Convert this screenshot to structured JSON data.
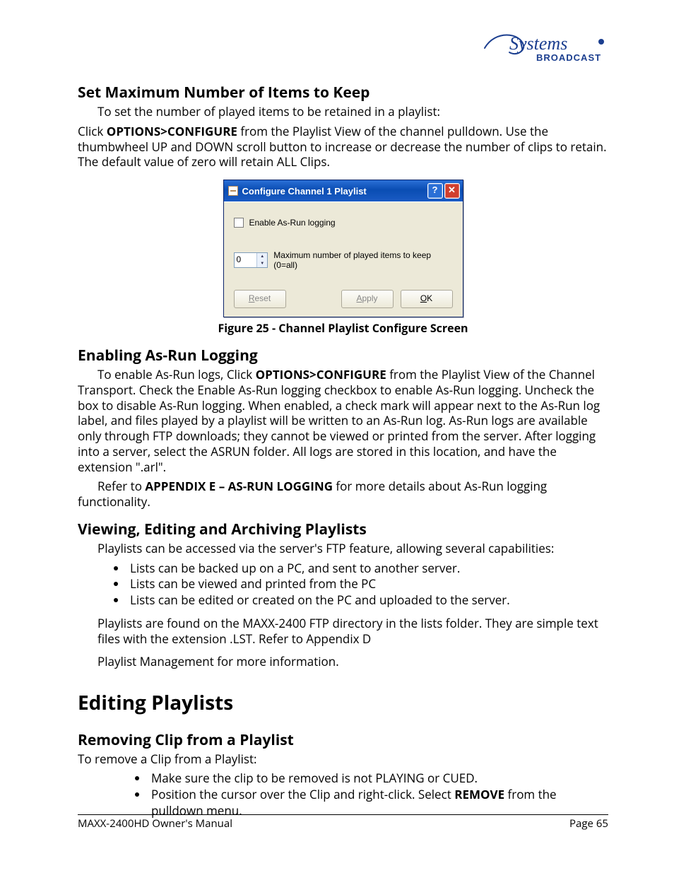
{
  "logo": {
    "brand_top": "360 Systems",
    "brand_sub": "BROADCAST"
  },
  "sec1": {
    "title": "Set Maximum Number of Items to Keep",
    "p1_a": "To set the number of played items to be retained in a playlist:",
    "p2_a": "Click ",
    "p2_b": "OPTIONS>CONFIGURE",
    "p2_c": " from the Playlist View of the channel pulldown. Use the thumbwheel UP and DOWN scroll button to increase or decrease the number of clips to retain. The default value of zero will retain ALL Clips."
  },
  "dialog": {
    "title": "Configure Channel 1 Playlist",
    "help_glyph": "?",
    "close_glyph": "✕",
    "enable_label": "Enable As-Run logging",
    "spin_value": "0",
    "spin_label": "Maximum number of played items to keep (0=all)",
    "reset_u": "R",
    "reset_rest": "eset",
    "apply_u": "A",
    "apply_rest": "pply",
    "ok_u": "O",
    "ok_rest": "K"
  },
  "fig_caption": "Figure 25 - Channel Playlist Configure Screen",
  "sec2": {
    "title": "Enabling As-Run Logging",
    "p1_a": "To enable As-Run logs, Click ",
    "p1_b": "OPTIONS>CONFIGURE",
    "p1_c": " from the Playlist View of the Channel Transport. Check the Enable As-Run logging checkbox to enable As-Run logging. Uncheck the box to disable As-Run logging.  When enabled, a check mark will appear next to the As-Run log label, and files played by a playlist will be written to an As-Run log. As-Run logs are available only through FTP downloads; they cannot be viewed or printed from the server.  After logging into a server, select the ASRUN folder.  All logs are stored in this location, and have the extension \".arl\".",
    "p2_a": "Refer to ",
    "p2_b": "APPENDIX E – AS-RUN LOGGING",
    "p2_c": " for more details about As-Run logging functionality."
  },
  "sec3": {
    "title": "Viewing, Editing and Archiving Playlists",
    "intro": "Playlists can be accessed via the server's FTP feature, allowing several capabilities:",
    "bullets": [
      "Lists can be backed up on a PC, and sent to another server.",
      "Lists can be viewed and printed from the PC",
      "Lists can be edited or created on the PC and uploaded to the server."
    ],
    "p_after": "Playlists are found on the MAXX-2400 FTP directory in the lists folder.  They are simple text files with the extension .LST.  Refer to Appendix D",
    "p_after2": "Playlist Management for more information."
  },
  "sec4_major": "Editing Playlists",
  "sec5": {
    "title": "Removing Clip from a Playlist",
    "intro": "To remove a Clip from a Playlist:",
    "b1": "Make sure the clip to be removed is not PLAYING or CUED.",
    "b2_a": "Position the cursor over the Clip and right-click. Select ",
    "b2_b": "REMOVE",
    "b2_c": " from the pulldown menu."
  },
  "footer": {
    "left": "MAXX-2400HD Owner's Manual",
    "right": "Page 65"
  }
}
